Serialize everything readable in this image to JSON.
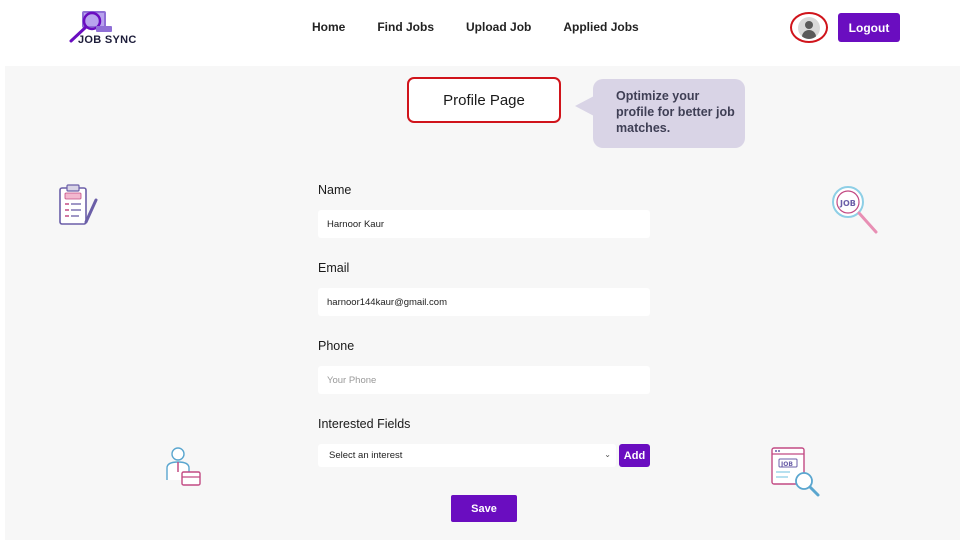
{
  "header": {
    "logo_text": "JOB SYNC",
    "nav": [
      {
        "label": "Home"
      },
      {
        "label": "Find Jobs"
      },
      {
        "label": "Upload Job"
      },
      {
        "label": "Applied Jobs"
      }
    ],
    "logout_label": "Logout"
  },
  "main": {
    "title": "Profile Page",
    "tip": "Optimize your profile for better job matches.",
    "form": {
      "name_label": "Name",
      "name_value": "Harnoor Kaur",
      "email_label": "Email",
      "email_value": "harnoor144kaur@gmail.com",
      "phone_label": "Phone",
      "phone_placeholder": "Your Phone",
      "interest_label": "Interested Fields",
      "interest_select_value": "Select an interest",
      "add_label": "Add",
      "save_label": "Save"
    },
    "icons": {
      "left_top": "job-clipboard-icon",
      "right_top": "job-search-icon",
      "left_bottom": "job-seeker-icon",
      "right_bottom": "job-browser-icon"
    }
  },
  "colors": {
    "accent": "#6a0dc0",
    "highlight": "#d0141b",
    "tip_bg": "#d9d4e6",
    "page_bg": "#f7f7f7"
  }
}
